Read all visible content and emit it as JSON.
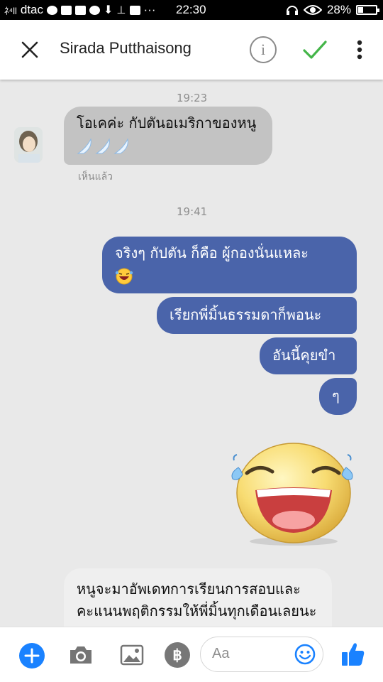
{
  "status_bar": {
    "carrier": "dtac",
    "signal_text": "ﾈ⁴ll",
    "dots": "···",
    "time": "22:30",
    "battery": "28%",
    "battery_level": 0.28
  },
  "header": {
    "contact_name": "Sirada Putthaisong",
    "info_icon_letter": "i"
  },
  "conversation": {
    "time_1": "19:23",
    "incoming_1": "โอเคค่ะ กัปตันอเมริกาของหนู",
    "seen": "เห็นแล้ว",
    "time_2": "19:41",
    "outgoing_1": "จริงๆ กัปตัน ก็คือ ผู้กองนั่นแหละ",
    "outgoing_2": "เรียกพี่มิ้นธรรมดาก็พอนะ",
    "outgoing_3": "อันนี้คุยขำ",
    "outgoing_4": "ๆ",
    "incoming_2": "หนูจะมาอัพเดทการเรียนการสอบและคะแนนพฤติกรรมให้พี่มิ้นทุกเดือนเลยนะคะ"
  },
  "composer": {
    "placeholder": "Aa",
    "baht_symbol": "฿"
  },
  "colors": {
    "outgoing_bubble": "#4a64aa",
    "incoming_bubble": "#c3c3c3",
    "accent_blue": "#1a82ff",
    "check_green": "#44b549"
  }
}
